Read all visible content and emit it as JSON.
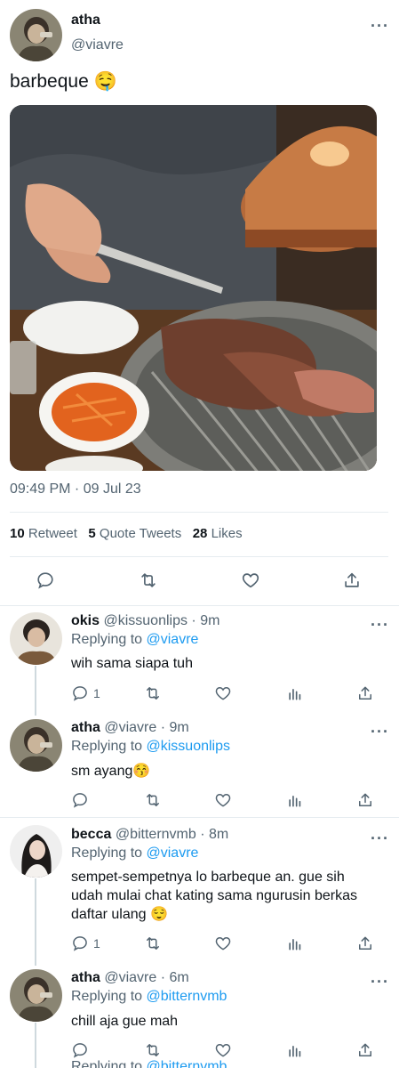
{
  "tweet": {
    "name": "atha",
    "handle": "@viavre",
    "text": "barbeque 🤤",
    "timestamp": "09:49 PM · 09 Jul 23",
    "retweets_count": "10",
    "retweets_label": "Retweet",
    "quotes_count": "5",
    "quotes_label": "Quote Tweets",
    "likes_count": "28",
    "likes_label": "Likes"
  },
  "replies": [
    {
      "name": "okis",
      "handle": "@kissuonlips",
      "time": "· 9m",
      "replying_prefix": "Replying to",
      "replying_to": "@viavre",
      "text": "wih sama siapa tuh",
      "reply_count": "1"
    },
    {
      "name": "atha",
      "handle": "@viavre",
      "time": "· 9m",
      "replying_prefix": "Replying to",
      "replying_to": "@kissuonlips",
      "text": "sm ayang😚",
      "reply_count": ""
    },
    {
      "name": "becca",
      "handle": "@bitternvmb",
      "time": "· 8m",
      "replying_prefix": "Replying to",
      "replying_to": "@viavre",
      "text": "sempet-sempetnya lo barbeque an. gue sih udah mulai chat kating sama ngurusin berkas daftar ulang 😌",
      "reply_count": "1"
    },
    {
      "name": "atha",
      "handle": "@viavre",
      "time": "· 6m",
      "replying_prefix": "Replying to",
      "replying_to": "@bitternvmb",
      "text": "chill aja gue mah",
      "reply_count": ""
    }
  ],
  "partial_row": {
    "replying_prefix": "Replying to",
    "replying_to": "@bitternvmb"
  },
  "colors": {
    "accent": "#1d9bf0",
    "muted": "#536471",
    "divider": "#e6ecf0"
  },
  "icons": [
    "more-icon",
    "reply-icon",
    "retweet-icon",
    "like-icon",
    "share-icon",
    "analytics-icon"
  ]
}
